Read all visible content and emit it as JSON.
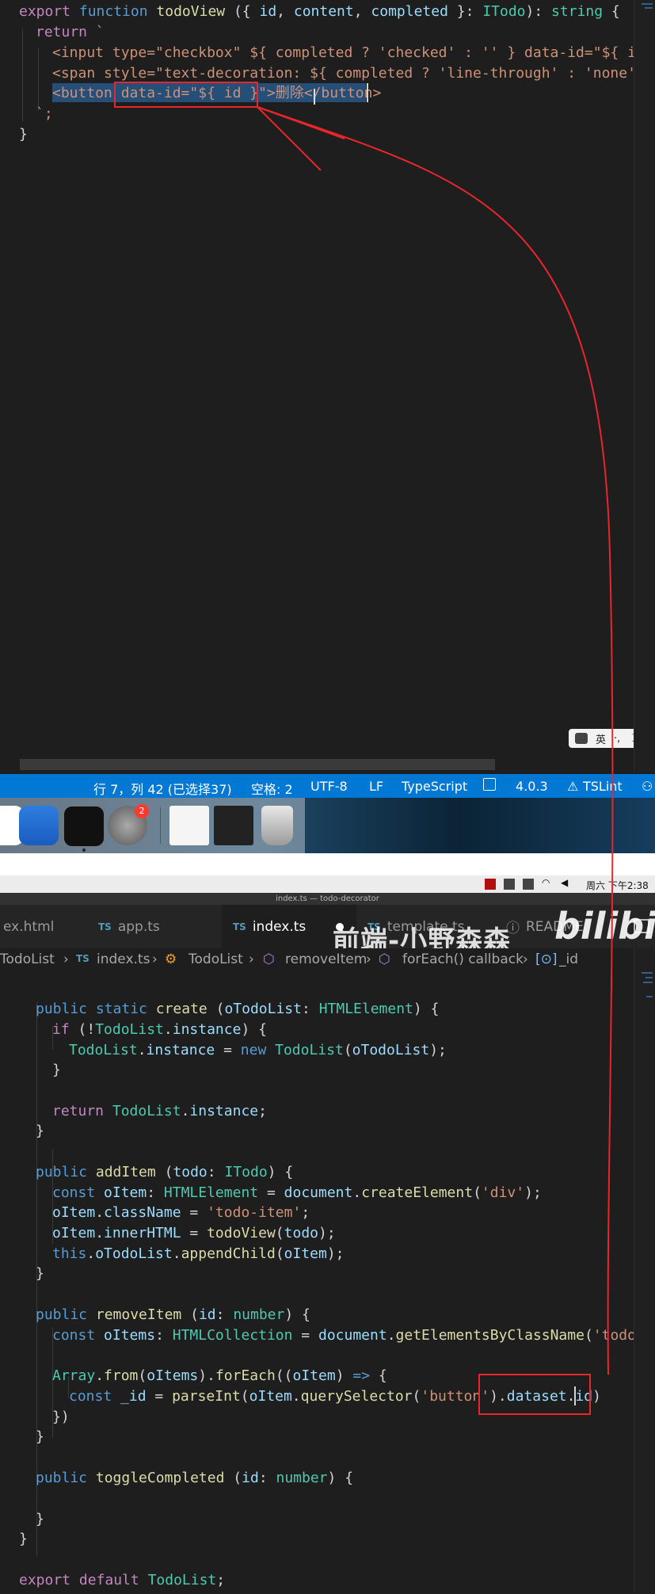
{
  "top_code": {
    "line1": {
      "kw": "export",
      "fn_kw": "function",
      "name": "todoView",
      "rest1": " ({ ",
      "p1": "id",
      "c1": ", ",
      "p2": "content",
      "c2": ", ",
      "p3": "completed",
      "rest2": " }: ",
      "type": "ITodo",
      "rest3": "): ",
      "ret": "string",
      "rest4": " {"
    },
    "line2": {
      "kw": "return",
      "tick": " `"
    },
    "line3": "<input type=\"checkbox\" ${ completed ? 'checked' : '' } data-id=\"${ id }\"",
    "line4": "<span style=\"text-decoration: ${ completed ? 'line-through' : 'none' }\">",
    "line5": "<button data-id=\"${ id }\">删除</button>",
    "line6": "`;",
    "line7": "}"
  },
  "ime": {
    "lang": "英",
    "sep": "·,",
    "moon": "☽"
  },
  "statusbar": {
    "position": "行 7，列 42 (已选择37)",
    "spaces": "空格: 2",
    "encoding": "UTF-8",
    "eol": "LF",
    "language": "TypeScript",
    "version": "4.0.3",
    "lint": "TSLint"
  },
  "dock": {
    "badge": "2"
  },
  "menubar": {
    "datetime": "周六 下午2:38"
  },
  "window": {
    "title": "index.ts — todo-decorator"
  },
  "tabs": [
    {
      "label": "ex.html"
    },
    {
      "label": "app.ts",
      "badge": "TS"
    },
    {
      "label": "index.ts",
      "badge": "TS"
    },
    {
      "label": "template.ts",
      "badge": "TS"
    },
    {
      "label": "README",
      "badge": "ⓘ"
    }
  ],
  "breadcrumb": {
    "folder": "TodoList",
    "file": "index.ts",
    "cls": "TodoList",
    "method": "removeItem",
    "cb": "forEach() callback",
    "prop": "_id"
  },
  "watermark": {
    "text": "前端-小野森森",
    "brand": "bilibi"
  },
  "bottom_code": [
    "public static create (oTodoList: HTMLElement) {",
    "if (!TodoList.instance) {",
    "TodoList.instance = new TodoList(oTodoList);",
    "}",
    "",
    "return TodoList.instance;",
    "}",
    "",
    "public addItem (todo: ITodo) {",
    "const oItem: HTMLElement = document.createElement('div');",
    "oItem.className = 'todo-item';",
    "oItem.innerHTML = todoView(todo);",
    "this.oTodoList.appendChild(oItem);",
    "}",
    "",
    "public removeItem (id: number) {",
    "const oItems: HTMLCollection = document.getElementsByClassName('todo-ite",
    "",
    "Array.from(oItems).forEach((oItem) => {",
    "const _id = parseInt(oItem.querySelector('button').dataset.id)",
    "})",
    "}",
    "",
    "public toggleCompleted (id: number) {",
    "",
    "}",
    "}",
    "",
    "export default TodoList;"
  ],
  "colors": {
    "accent": "#0078d4",
    "annotation": "#e8262b",
    "selection": "#264f78"
  }
}
